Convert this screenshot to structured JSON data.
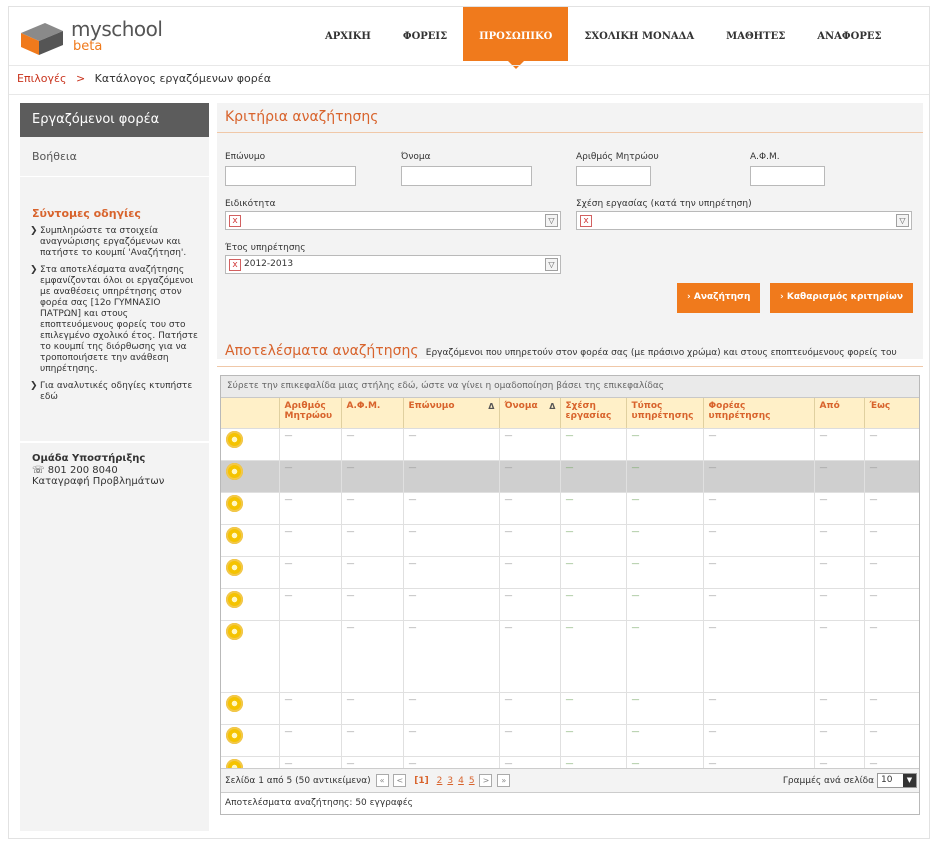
{
  "brand": {
    "name": "myschool",
    "sub": "beta"
  },
  "nav": {
    "items": [
      "ΑΡΧΙΚΗ",
      "ΦΟΡΕΙΣ",
      "ΠΡΟΣΩΠΙΚΟ",
      "ΣΧΟΛΙΚΗ ΜΟΝΑΔΑ",
      "ΜΑΘΗΤΕΣ",
      "ΑΝΑΦΟΡΕΣ"
    ],
    "active": "ΠΡΟΣΩΠΙΚΟ"
  },
  "breadcrumb": {
    "link": "Επιλογές",
    "sep": ">",
    "current": "Κατάλογος εργαζόμενων φορέα"
  },
  "sidebar": {
    "title": "Εργαζόμενοι φορέα",
    "help": "Βοήθεια",
    "shortcut_title": "Σύντομες οδηγίες",
    "shortcuts": [
      "Συμπληρώστε τα στοιχεία αναγνώρισης εργαζόμενων και πατήστε το κουμπί 'Αναζήτηση'.",
      "Στα αποτελέσματα αναζήτησης εμφανίζονται όλοι οι εργαζόμενοι με αναθέσεις υπηρέτησης στον φορέα σας [12ο ΓΥΜΝΑΣΙΟ ΠΑΤΡΩΝ] και στους εποπτευόμενους φορείς του στο επιλεγμένο σχολικό έτος. Πατήστε το κουμπί της διόρθωσης για να τροποποιήσετε την ανάθεση υπηρέτησης.",
      "Για αναλυτικές οδηγίες κτυπήστε εδώ"
    ],
    "support_title": "Ομάδα Υποστήριξης",
    "support_phone": "801 200 8040",
    "support_link": "Καταγραφή Προβλημάτων"
  },
  "criteria": {
    "title": "Κριτήρια αναζήτησης",
    "labels": {
      "surname": "Επώνυμο",
      "name": "Όνομα",
      "registry": "Αριθμός Μητρώου",
      "afm": "Α.Φ.Μ.",
      "specialty": "Ειδικότητα",
      "relation": "Σχέση εργασίας (κατά την υπηρέτηση)",
      "year": "Έτος υπηρέτησης"
    },
    "year_value": "2012-2013",
    "search_button": "Αναζήτηση",
    "clear_button": "Καθαρισμός κριτηρίων"
  },
  "results": {
    "title": "Αποτελέσματα αναζήτησης",
    "desc": "Εργαζόμενοι που υπηρετούν στον φορέα σας (με πράσινο χρώμα) και στους εποπτευόμενους φορείς του",
    "group_hint": "Σύρετε την επικεφαλίδα μιας στήλης εδώ, ώστε να γίνει η ομαδοποίηση βάσει της επικεφαλίδας",
    "columns": [
      "",
      "Αριθμός Μητρώου",
      "Α.Φ.Μ.",
      "Επώνυμο",
      "Όνομα",
      "Σχέση εργασίας",
      "Τύπος υπηρέτησης",
      "Φορέας υπηρέτησης",
      "Από",
      "Έως"
    ],
    "sort_mark": "Δ",
    "rows": [
      {
        "cells": [
          "—",
          "—",
          "—",
          "—",
          "—",
          "—",
          "—",
          "—",
          "—"
        ],
        "tall": false,
        "highlight": false,
        "gear": true
      },
      {
        "cells": [
          "—",
          "—",
          "—",
          "—",
          "—",
          "—",
          "—",
          "—",
          "—"
        ],
        "tall": false,
        "highlight": true,
        "gear": true
      },
      {
        "cells": [
          "—",
          "—",
          "—",
          "—",
          "—",
          "—",
          "—",
          "—",
          "—"
        ],
        "tall": false,
        "highlight": false,
        "gear": true
      },
      {
        "cells": [
          "—",
          "—",
          "—",
          "—",
          "—",
          "—",
          "—",
          "—",
          "—"
        ],
        "tall": false,
        "highlight": false,
        "gear": true
      },
      {
        "cells": [
          "—",
          "—",
          "—",
          "—",
          "—",
          "—",
          "—",
          "—",
          "—"
        ],
        "tall": false,
        "highlight": false,
        "gear": true
      },
      {
        "cells": [
          "—",
          "—",
          "—",
          "—",
          "—",
          "—",
          "—",
          "—",
          "—"
        ],
        "tall": false,
        "highlight": false,
        "gear": true
      },
      {
        "cells": [
          "",
          "—",
          "—",
          "—",
          "—",
          "—",
          "—",
          "—",
          "—"
        ],
        "tall": true,
        "highlight": false,
        "gear": true
      },
      {
        "cells": [
          "—",
          "—",
          "—",
          "—",
          "—",
          "—",
          "—",
          "—",
          "—"
        ],
        "tall": false,
        "highlight": false,
        "gear": true
      },
      {
        "cells": [
          "—",
          "—",
          "—",
          "—",
          "—",
          "—",
          "—",
          "—",
          "—"
        ],
        "tall": false,
        "highlight": false,
        "gear": true
      },
      {
        "cells": [
          "—",
          "—",
          "—",
          "—",
          "—",
          "—",
          "—",
          "—",
          "—"
        ],
        "tall": false,
        "highlight": false,
        "gear": true
      }
    ],
    "pager": {
      "text": "Σελίδα 1 από 5 (50 αντικείμενα)",
      "first": "«",
      "prev": "<",
      "current": "[1]",
      "pages": [
        "2",
        "3",
        "4",
        "5"
      ],
      "next": ">",
      "last": "»",
      "rows_label": "Γραμμές ανά σελίδα",
      "rows_value": "10",
      "dd_arrow": "▼"
    },
    "footer": "Αποτελέσματα αναζήτησης: 50 εγγραφές"
  },
  "colors": {
    "accent": "#f07a1c",
    "header_bg": "#fff0c8",
    "sidebar_title": "#5c5c5c"
  }
}
